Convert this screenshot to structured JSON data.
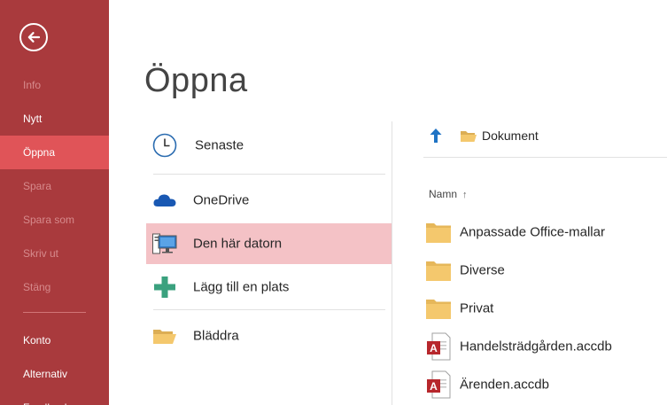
{
  "sidebar": {
    "items": [
      {
        "label": "Info",
        "state": "disabled"
      },
      {
        "label": "Nytt",
        "state": "normal"
      },
      {
        "label": "Öppna",
        "state": "active"
      },
      {
        "label": "Spara",
        "state": "disabled"
      },
      {
        "label": "Spara som",
        "state": "disabled"
      },
      {
        "label": "Skriv ut",
        "state": "disabled"
      },
      {
        "label": "Stäng",
        "state": "disabled"
      },
      {
        "label": "Konto",
        "state": "normal"
      },
      {
        "label": "Alternativ",
        "state": "normal"
      },
      {
        "label": "Feedback",
        "state": "normal"
      }
    ],
    "back_icon": "back-arrow-circle-icon",
    "colors": {
      "background": "#a93a3d",
      "active": "#e05458",
      "disabled_text": "#d68a8c"
    }
  },
  "main": {
    "title": "Öppna",
    "places": [
      {
        "label": "Senaste",
        "icon": "clock-icon"
      },
      {
        "label": "OneDrive",
        "icon": "cloud-icon"
      },
      {
        "label": "Den här datorn",
        "icon": "computer-icon",
        "selected": true
      },
      {
        "label": "Lägg till en plats",
        "icon": "plus-icon"
      },
      {
        "label": "Bläddra",
        "icon": "folder-open-icon"
      }
    ],
    "selected_color": "#f4c2c6"
  },
  "browser": {
    "breadcrumb": "Dokument",
    "column_header": "Namn",
    "sort_indicator": "↑",
    "files": [
      {
        "name": "Anpassade Office-mallar",
        "icon": "folder-icon"
      },
      {
        "name": "Diverse",
        "icon": "folder-icon"
      },
      {
        "name": "Privat",
        "icon": "folder-icon"
      },
      {
        "name": "Handelsträdgården.accdb",
        "icon": "access-file-icon"
      },
      {
        "name": "Ärenden.accdb",
        "icon": "access-file-icon"
      }
    ]
  }
}
